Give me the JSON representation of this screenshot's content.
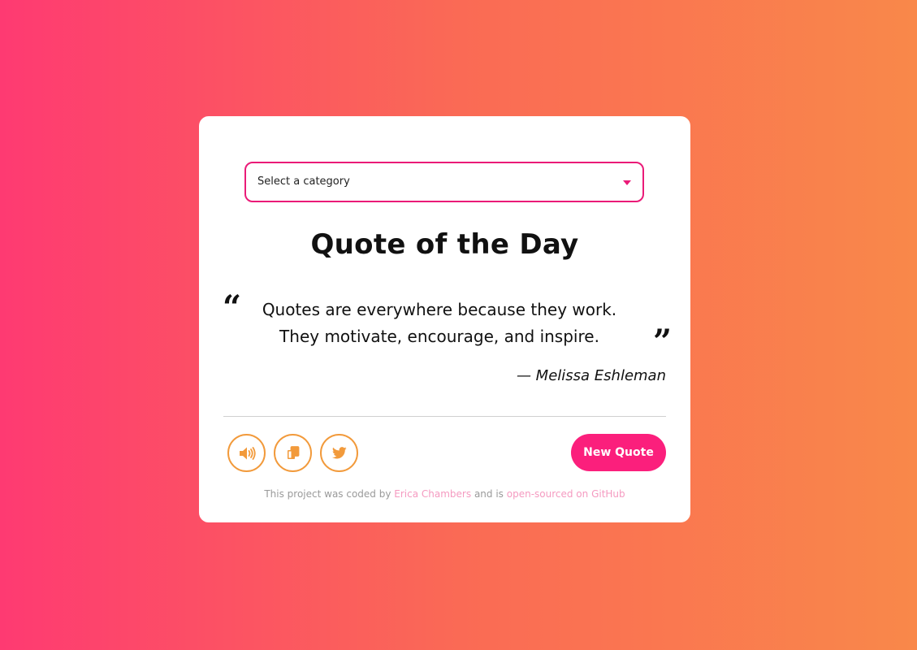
{
  "category_select": {
    "selected": "Select a category"
  },
  "title": "Quote of the Day",
  "quote": {
    "open_mark": "“",
    "close_mark": "”",
    "text_line1": "Quotes are everywhere because they work.",
    "text_line2": "They motivate, encourage, and inspire.",
    "author": "— Melissa Eshleman"
  },
  "actions": {
    "speak_icon": "volume-icon",
    "copy_icon": "copy-icon",
    "tweet_icon": "twitter-icon",
    "new_quote_label": "New Quote"
  },
  "footer": {
    "prefix": "This project was coded by",
    "author_link": "Erica Chambers",
    "middle": "and is",
    "repo_link": "open-sourced on GitHub"
  },
  "colors": {
    "accent_pink": "#fb1f7c",
    "icon_orange": "#f29a3b",
    "gradient_start": "#fe3a72",
    "gradient_end": "#f9884a"
  }
}
